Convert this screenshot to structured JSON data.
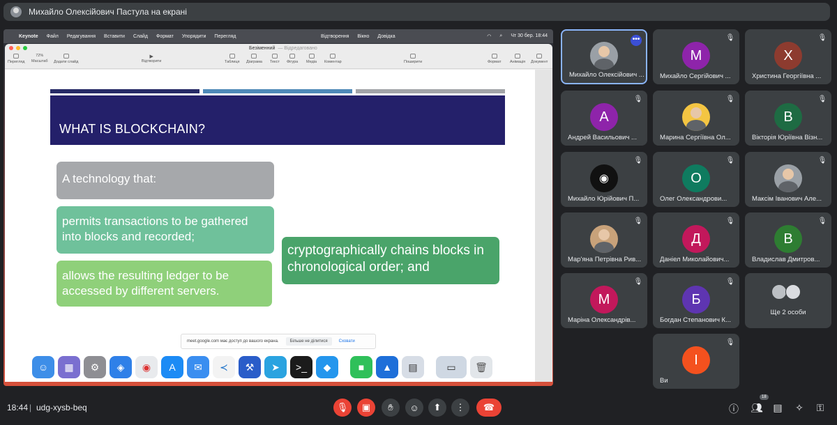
{
  "presenter_bar": {
    "label": "Михайло Олексійович Пастула на екрані"
  },
  "mac_menubar": {
    "apple": "",
    "app_name": "Keynote",
    "items": [
      "Файл",
      "Редагування",
      "Вставити",
      "Слайд",
      "Формат",
      "Упорядити",
      "Перегляд"
    ],
    "mid_items": [
      "Відтворення",
      "Вікно",
      "Довідка"
    ],
    "clock": "Чт 30 бер.  18:44"
  },
  "keynote": {
    "doc_title": "Безіменний",
    "doc_subtitle": "— Відредаговано",
    "toolbar": {
      "view": "Перегляд",
      "zoom_value": "72%",
      "zoom": "Масштаб",
      "add_slide": "Додати слайд",
      "play": "Відтворити",
      "table": "Таблиця",
      "chart": "Діаграма",
      "text": "Текст",
      "shape": "Фігура",
      "media": "Медіа",
      "comment": "Коментар",
      "share": "Поширити",
      "format": "Формат",
      "animate": "Анімація",
      "document": "Документ"
    }
  },
  "slide": {
    "title": "WHAT IS BLOCKCHAIN?",
    "box1": "A technology that:",
    "box2": "permits transactions to be gathered into blocks and recorded;",
    "box3": "allows the resulting ledger to be accessed by different servers.",
    "box4": "cryptographically chains blocks in chronological order;  and"
  },
  "share_notice": {
    "text": "meet.google.com має доступ до вашого екрана.",
    "stop": "Більше не ділитися",
    "hide": "Сховати"
  },
  "dock_apps": [
    "Finder",
    "Launchpad",
    "System Settings",
    "Safari",
    "Chrome",
    "App Store",
    "Mail",
    "VS Code",
    "Xcode",
    "Telegram",
    "Terminal",
    "Docker",
    "FaceTime",
    "Keynote",
    "Preview",
    "Screen",
    "Trash"
  ],
  "participants": [
    {
      "name": "Михайло Олексійович ...",
      "initial": "",
      "color": "#5f6368",
      "photo": true,
      "active": true
    },
    {
      "name": "Михайло Сергійович ...",
      "initial": "М",
      "color": "#8e24aa"
    },
    {
      "name": "Христина Георгіївна ...",
      "initial": "Х",
      "color": "#8d3b2f"
    },
    {
      "name": "Андрей Васильович ...",
      "initial": "А",
      "color": "#8e24aa"
    },
    {
      "name": "Марина Сергіївна Ол...",
      "initial": "",
      "color": "#f4c542",
      "photo": true
    },
    {
      "name": "Вікторія Юріївна Візн...",
      "initial": "В",
      "color": "#1e6b43"
    },
    {
      "name": "Михайло Юрійович П...",
      "initial": "",
      "color": "#111111",
      "photo": true
    },
    {
      "name": "Олег Олександрови...",
      "initial": "О",
      "color": "#0f7b5f"
    },
    {
      "name": "Максім Іванович Але...",
      "initial": "",
      "color": "#9aa0a6",
      "photo": true
    },
    {
      "name": "Мар'яна Петрівна Рив...",
      "initial": "",
      "color": "#c8a27a",
      "photo": true
    },
    {
      "name": "Даніел Миколайович...",
      "initial": "Д",
      "color": "#c2185b"
    },
    {
      "name": "Владислав Дмитров...",
      "initial": "В",
      "color": "#2e7d32"
    },
    {
      "name": "Маріна Олександрів...",
      "initial": "М",
      "color": "#c2185b"
    },
    {
      "name": "Богдан Степанович К...",
      "initial": "Б",
      "color": "#5e35b1"
    },
    {
      "name": "Ще 2 особи",
      "initial": "",
      "group": true
    },
    {
      "name": "Ви",
      "initial": "І",
      "color": "#f4511e"
    }
  ],
  "more_button": "•••",
  "bottom": {
    "time": "18:44",
    "separator": "|",
    "meeting_code": "udg-xysb-beq",
    "people_count": "18"
  }
}
